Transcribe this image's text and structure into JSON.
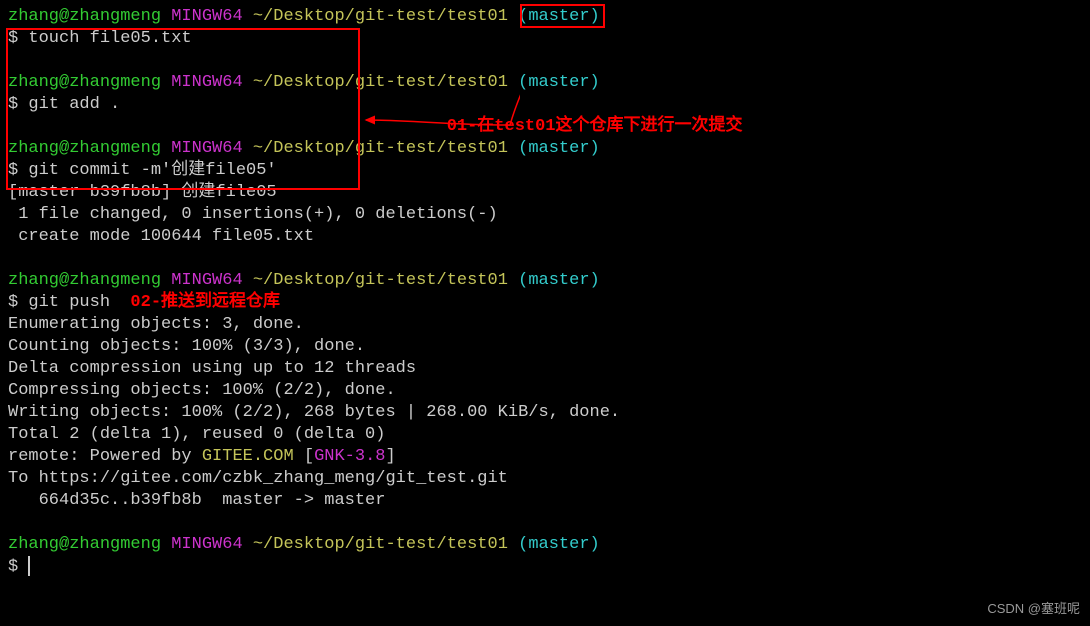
{
  "prompt": {
    "user": "zhang@zhangmeng",
    "shell": "MINGW64",
    "path_prefix": "~/Desktop/git-test/",
    "repo": "test01",
    "branch": "(master)"
  },
  "cmds": {
    "touch": "$ touch file05.txt",
    "add": "$ git add .",
    "commit": "$ git commit -m'创建file05'",
    "push_prefix": "$ git push  ",
    "empty": "$ "
  },
  "annotations": {
    "a1": "01-在test01这个仓库下进行一次提交",
    "a2": "02-推送到远程仓库"
  },
  "commit_out": {
    "l1": "[master b39fb8b] 创建file05",
    "l2": " 1 file changed, 0 insertions(+), 0 deletions(-)",
    "l3": " create mode 100644 file05.txt"
  },
  "push_out": {
    "l1": "Enumerating objects: 3, done.",
    "l2": "Counting objects: 100% (3/3), done.",
    "l3": "Delta compression using up to 12 threads",
    "l4": "Compressing objects: 100% (2/2), done.",
    "l5": "Writing objects: 100% (2/2), 268 bytes | 268.00 KiB/s, done.",
    "l6": "Total 2 (delta 1), reused 0 (delta 0)",
    "l7a": "remote: Powered by ",
    "l7b": "GITEE.COM",
    "l7c": " [",
    "l7d": "GNK-3.8",
    "l7e": "]",
    "l8": "To https://gitee.com/czbk_zhang_meng/git_test.git",
    "l9": "   664d35c..b39fb8b  master -> master"
  },
  "watermark": "CSDN @塞班呢"
}
